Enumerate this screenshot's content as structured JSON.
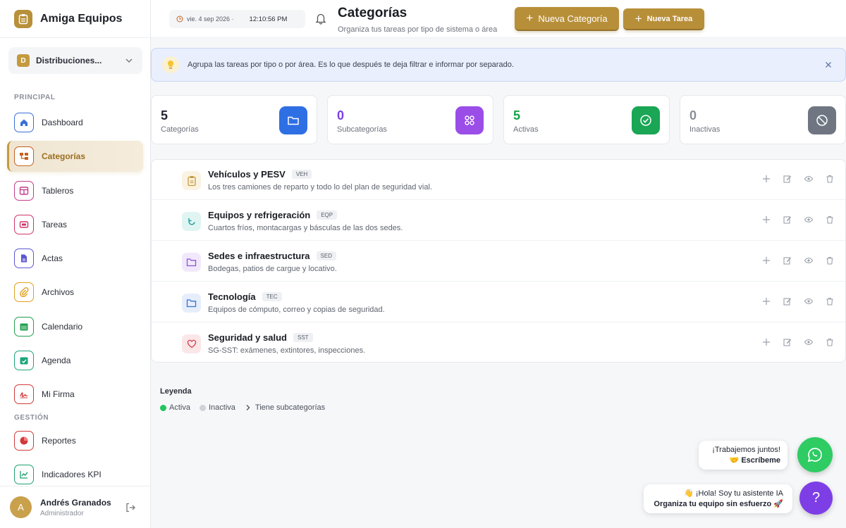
{
  "brand": {
    "name": "Amiga Equipos"
  },
  "org": {
    "badge": "D",
    "name": "Distribuciones..."
  },
  "sections": {
    "principal": "PRINCIPAL",
    "gestion": "GESTIÓN"
  },
  "nav": [
    {
      "label": "Dashboard",
      "icon": "home-icon",
      "color": "#3b6fd6"
    },
    {
      "label": "Categorías",
      "icon": "category-icon",
      "color": "#c7611f"
    },
    {
      "label": "Tableros",
      "icon": "board-icon",
      "color": "#c23c8a"
    },
    {
      "label": "Tareas",
      "icon": "tasks-icon",
      "color": "#d0346c"
    },
    {
      "label": "Actas",
      "icon": "document-icon",
      "color": "#5b57d1"
    },
    {
      "label": "Archivos",
      "icon": "paperclip-icon",
      "color": "#e0a020"
    },
    {
      "label": "Calendario",
      "icon": "calendar-icon",
      "color": "#20a050"
    },
    {
      "label": "Agenda",
      "icon": "agenda-icon",
      "color": "#1aa57a"
    },
    {
      "label": "Mi Firma",
      "icon": "signature-icon",
      "color": "#d03a3a"
    },
    {
      "label": "Reportes",
      "icon": "pie-chart-icon",
      "color": "#d03a3a"
    },
    {
      "label": "Indicadores KPI",
      "icon": "line-chart-icon",
      "color": "#20a070"
    }
  ],
  "user": {
    "initial": "A",
    "name": "Andrés Granados",
    "role": "Administrador"
  },
  "topbar": {
    "date": "vie. 4 sep 2026 ·",
    "time": "12:10:56 PM",
    "title": "Categorías",
    "subtitle": "Organiza tus tareas por tipo de sistema o área",
    "new_category": "Nueva Categoría",
    "new_task": "Nueva Tarea"
  },
  "banner": {
    "text": "Agrupa las tareas por tipo o por área. Es lo que después te deja filtrar e informar por separado."
  },
  "stats": [
    {
      "value": "5",
      "label": "Categorías",
      "color": "#1f2430",
      "icon": "folder-icon",
      "bg": "#2f6fe4"
    },
    {
      "value": "0",
      "label": "Subcategorías",
      "color": "#7b3fe4",
      "icon": "grid-icon",
      "bg": "#9b4de8"
    },
    {
      "value": "5",
      "label": "Activas",
      "color": "#16a34a",
      "icon": "check-circle-icon",
      "bg": "#1aa655"
    },
    {
      "value": "0",
      "label": "Inactivas",
      "color": "#8a8f99",
      "icon": "ban-icon",
      "bg": "#6f7682"
    }
  ],
  "categories": [
    {
      "name": "Vehículos y PESV",
      "code": "VEH",
      "desc": "Los tres camiones de reparto y todo lo del plan de seguridad vial.",
      "icon": "clipboard-icon",
      "color": "#c49a3f",
      "bg": "#fbf3e2"
    },
    {
      "name": "Equipos y refrigeración",
      "code": "EQP",
      "desc": "Cuartos fríos, montacargas y básculas de las dos sedes.",
      "icon": "refresh-icon",
      "color": "#1a9e9a",
      "bg": "#e0f4f2"
    },
    {
      "name": "Sedes e infraestructura",
      "code": "SED",
      "desc": "Bodegas, patios de cargue y locativo.",
      "icon": "folder-icon",
      "color": "#8b54d9",
      "bg": "#f1e9fb"
    },
    {
      "name": "Tecnología",
      "code": "TEC",
      "desc": "Equipos de cómputo, correo y copias de seguridad.",
      "icon": "folder-icon",
      "color": "#3b6fd6",
      "bg": "#e6eefb"
    },
    {
      "name": "Seguridad y salud",
      "code": "SST",
      "desc": "SG-SST: exámenes, extintores, inspecciones.",
      "icon": "heart-icon",
      "color": "#d63a4a",
      "bg": "#fbe6e8"
    }
  ],
  "legend": {
    "title": "Leyenda",
    "active": "Activa",
    "inactive": "Inactiva",
    "sub": "Tiene subcategorías",
    "active_color": "#22c55e",
    "inactive_color": "#cfd2d8"
  },
  "chat": {
    "line1": "¡Trabajemos juntos!",
    "line2": "🤝 Escríbeme",
    "ai_line1": "👋 ¡Hola! Soy tu asistente IA",
    "ai_line2": "Organiza tu equipo sin esfuerzo 🚀",
    "help": "?"
  }
}
